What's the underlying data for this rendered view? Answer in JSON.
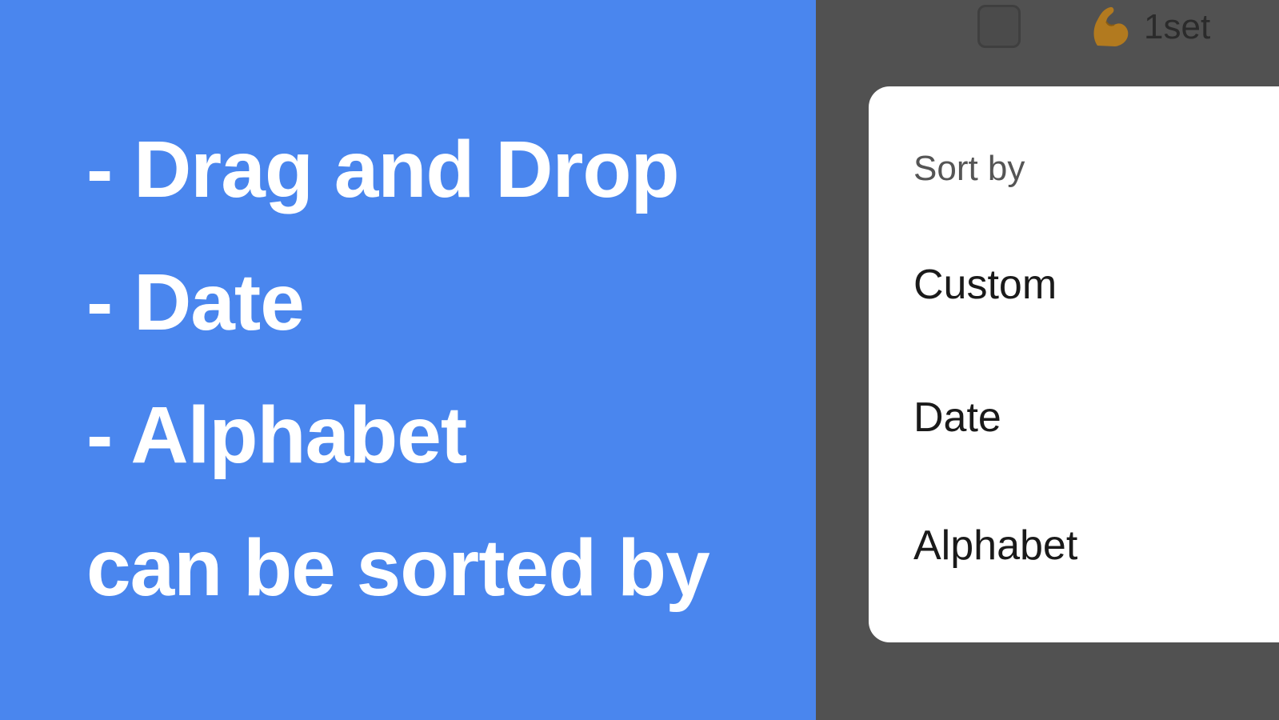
{
  "promo": {
    "lines": [
      "- Drag and Drop",
      "- Date",
      "- Alphabet",
      "can be sorted by"
    ],
    "background": "#4a86ee",
    "text_color": "#ffffff"
  },
  "toolbar": {
    "checkbox_checked": false,
    "set_icon": "flexed-biceps-icon",
    "set_label": "1set"
  },
  "sort_menu": {
    "header": "Sort by",
    "items": [
      {
        "label": "Custom"
      },
      {
        "label": "Date"
      },
      {
        "label": "Alphabet"
      }
    ]
  },
  "colors": {
    "app_background": "#515151",
    "menu_background": "#ffffff"
  }
}
